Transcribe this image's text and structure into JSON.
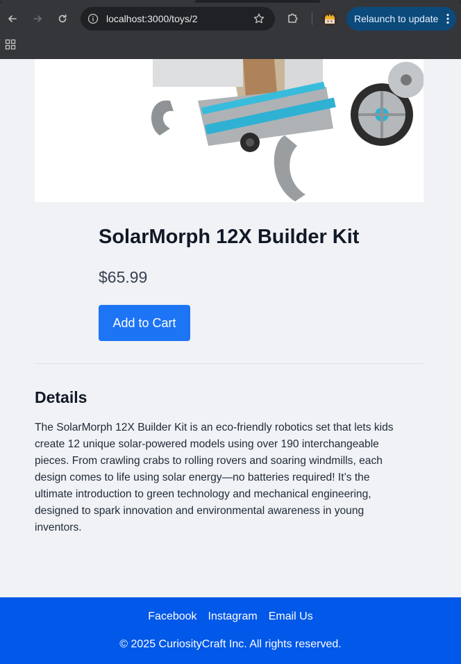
{
  "browser": {
    "url": "localhost:3000/toys/2",
    "relaunch_label": "Relaunch to update",
    "icons": {
      "back": "arrow-left-icon",
      "forward": "arrow-right-icon",
      "reload": "reload-icon",
      "site_info": "info-icon",
      "bookmark": "star-icon",
      "extensions": "puzzle-icon",
      "profile": "avatar",
      "menu": "kebab-menu-icon",
      "apps": "apps-grid-icon"
    }
  },
  "product": {
    "image_alt": "SolarMorph 12X robot",
    "title": "SolarMorph 12X Builder Kit",
    "price": "$65.99",
    "add_to_cart_label": "Add to Cart"
  },
  "details": {
    "heading": "Details",
    "description": "The SolarMorph 12X Builder Kit is an eco-friendly robotics set that lets kids create 12 unique solar-powered models using over 190 interchangeable pieces. From crawling crabs to rolling rovers and soaring windmills, each design comes to life using solar energy—no batteries required! It’s the ultimate introduction to green technology and mechanical engineering, designed to spark innovation and environmental awareness in young inventors."
  },
  "footer": {
    "links": [
      "Facebook",
      "Instagram",
      "Email Us"
    ],
    "copyright": "© 2025 CuriosityCraft Inc. All rights reserved."
  },
  "colors": {
    "primary_button": "#1d74f5",
    "footer_bg": "#0258e8",
    "page_bg": "#f0f2f5",
    "chrome_bg": "#35363a",
    "relaunch_bg": "#0b4a7a"
  }
}
